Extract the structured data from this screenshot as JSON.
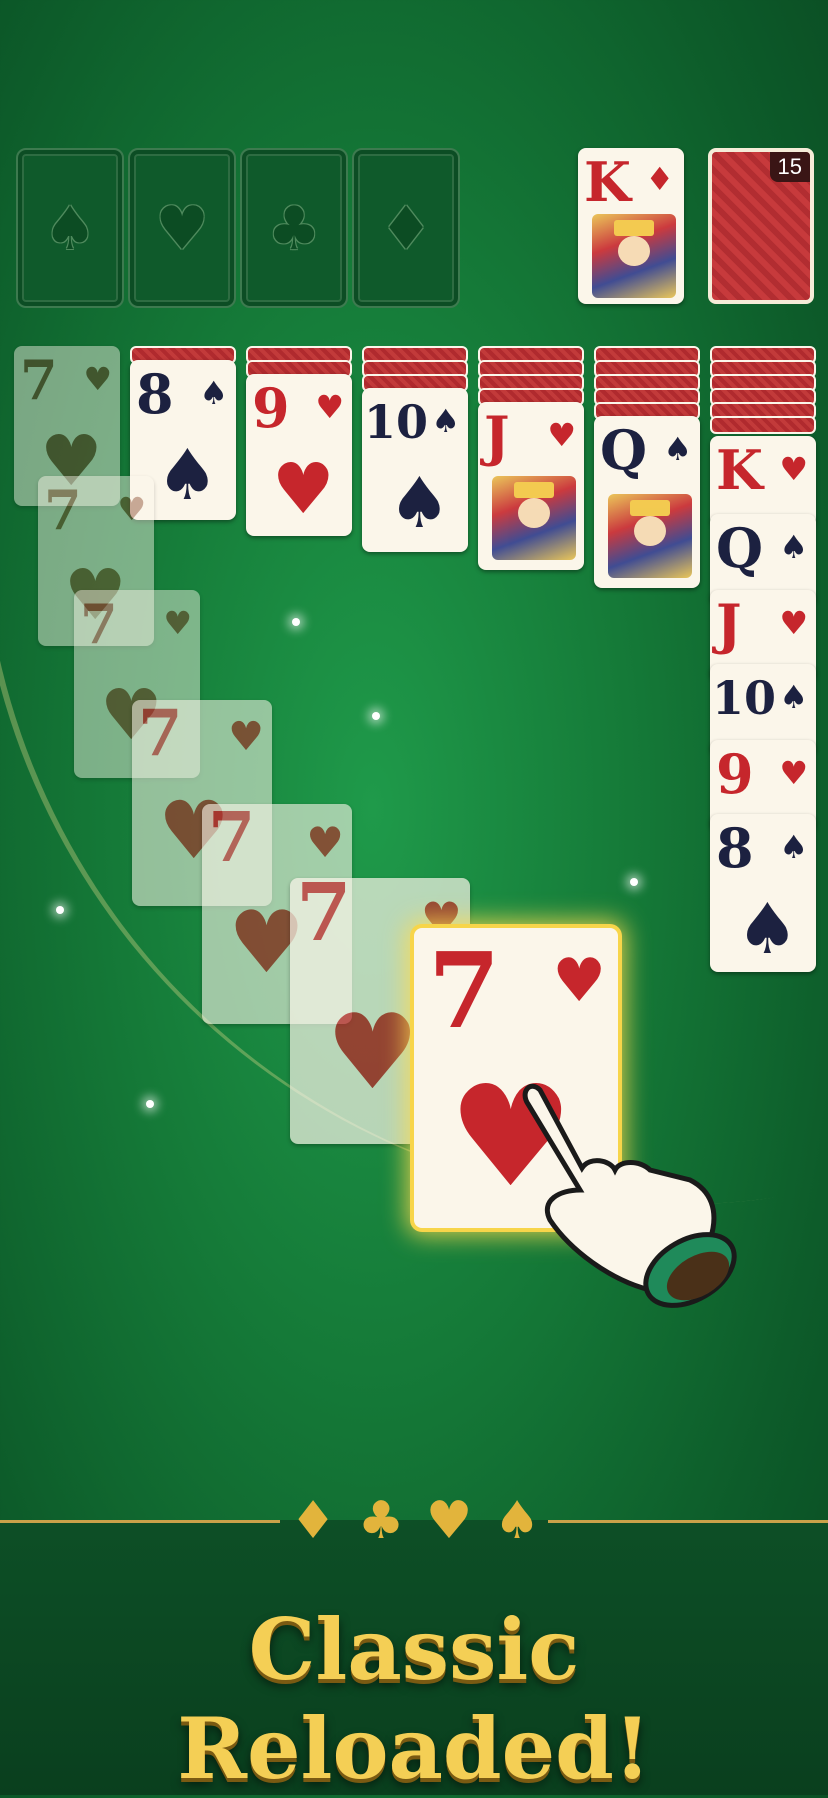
{
  "foundations": [
    {
      "suit_icon": "spade-icon",
      "glyph": "♠"
    },
    {
      "suit_icon": "heart-icon",
      "glyph": "♥"
    },
    {
      "suit_icon": "club-icon",
      "glyph": "♣"
    },
    {
      "suit_icon": "diamond-icon",
      "glyph": "♦"
    }
  ],
  "waste_card": {
    "rank": "K",
    "suit": "♦",
    "color": "red"
  },
  "stock": {
    "count": "15"
  },
  "tableau": [
    {
      "rank": "8",
      "suit": "♠"
    },
    {
      "rank": "9",
      "suit": "♥"
    },
    {
      "rank": "10",
      "suit": "♠"
    },
    {
      "rank": "J",
      "suit": "♥"
    },
    {
      "rank": "Q",
      "suit": "♠"
    },
    {
      "rank": "K",
      "suit": "♥"
    }
  ],
  "last_column_run": [
    {
      "rank": "Q",
      "suit": "♠"
    },
    {
      "rank": "J",
      "suit": "♥"
    },
    {
      "rank": "10",
      "suit": "♠"
    },
    {
      "rank": "9",
      "suit": "♥"
    },
    {
      "rank": "8",
      "suit": "♠"
    }
  ],
  "moving_card": {
    "rank": "7",
    "suit": "♥"
  },
  "tagline": "Classic Reloaded!",
  "colors": {
    "felt": "#157a38",
    "gold": "#f4cf55",
    "red": "#c6262c",
    "black": "#1c2140"
  },
  "hand_icon": "pointer-hand-icon"
}
